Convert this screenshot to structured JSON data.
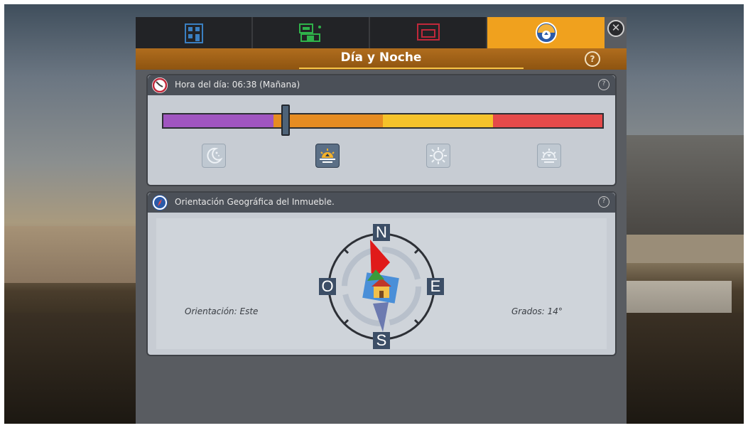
{
  "window": {
    "title": "Día y Noche",
    "tabs": [
      {
        "icon": "building-blueprint-icon",
        "color": "#3a7fc1",
        "active": false
      },
      {
        "icon": "furniture-plan-icon",
        "color": "#2fb24a",
        "active": false
      },
      {
        "icon": "interior-render-icon",
        "color": "#c0283a",
        "active": false
      },
      {
        "icon": "day-night-compass-icon",
        "color": "#f0a11e",
        "active": true
      }
    ]
  },
  "time_section": {
    "label": "Hora del día: 06:38  (Mañana)",
    "time_value": "06:38",
    "slider_fraction": 0.28,
    "phase_colors": [
      "#a055c0",
      "#e68c22",
      "#f5c22a",
      "#e54a4a"
    ],
    "phases": [
      {
        "icon": "moon-night-icon",
        "active": false
      },
      {
        "icon": "sunrise-icon",
        "active": true
      },
      {
        "icon": "sun-midday-icon",
        "active": false
      },
      {
        "icon": "sunset-icon",
        "active": false
      }
    ]
  },
  "orientation_section": {
    "label": "Orientación Geográfica del Inmueble.",
    "orientation_text": "Orientación: Este",
    "degrees_text": "Grados: 14°",
    "degrees_value": 14,
    "compass": {
      "north": "N",
      "south": "S",
      "east": "E",
      "west": "O"
    }
  }
}
